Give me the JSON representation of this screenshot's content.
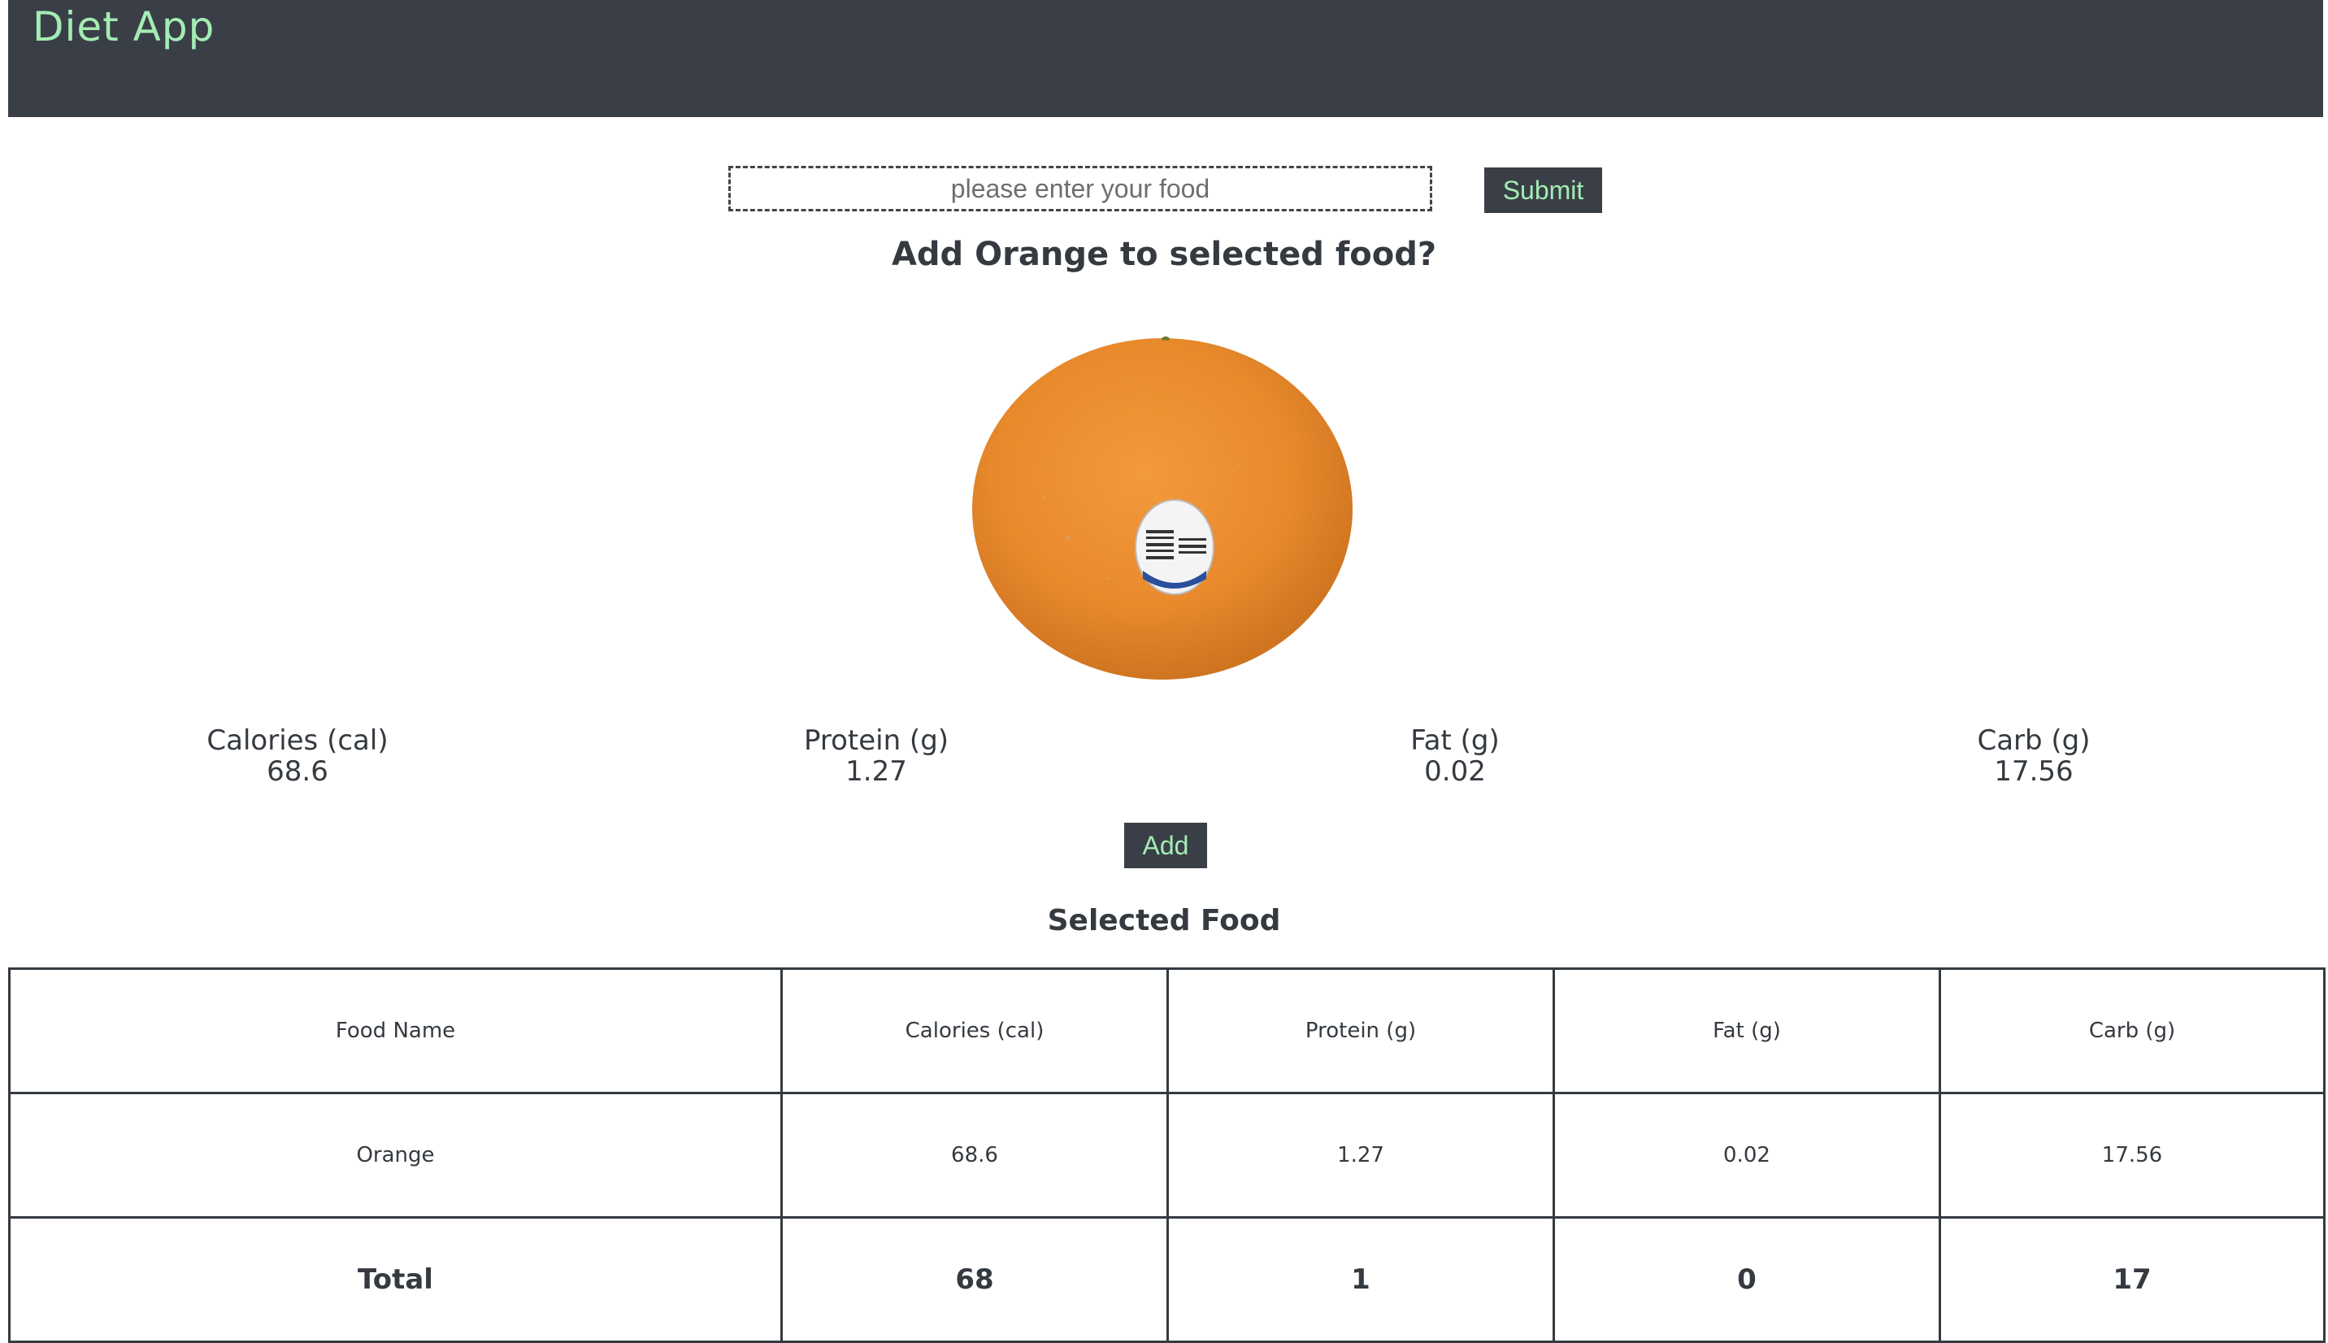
{
  "header": {
    "title": "Diet App"
  },
  "search": {
    "placeholder": "please enter your food",
    "value": "",
    "submit_label": "Submit"
  },
  "prompt": "Add Orange to selected food?",
  "food": {
    "name": "Orange",
    "image_icon": "orange-image",
    "nutrients": [
      {
        "label": "Calories (cal)",
        "value": "68.6"
      },
      {
        "label": "Protein (g)",
        "value": "1.27"
      },
      {
        "label": "Fat (g)",
        "value": "0.02"
      },
      {
        "label": "Carb (g)",
        "value": "17.56"
      }
    ],
    "add_label": "Add"
  },
  "selected": {
    "title": "Selected Food",
    "columns": [
      "Food Name",
      "Calories (cal)",
      "Protein (g)",
      "Fat (g)",
      "Carb (g)"
    ],
    "rows": [
      [
        "Orange",
        "68.6",
        "1.27",
        "0.02",
        "17.56"
      ]
    ],
    "total": [
      "Total",
      "68",
      "1",
      "0",
      "17"
    ]
  },
  "colors": {
    "header_bg": "#3a3f47",
    "accent": "#a4ecb4",
    "text": "#343a40",
    "orange": "#e8892c"
  }
}
